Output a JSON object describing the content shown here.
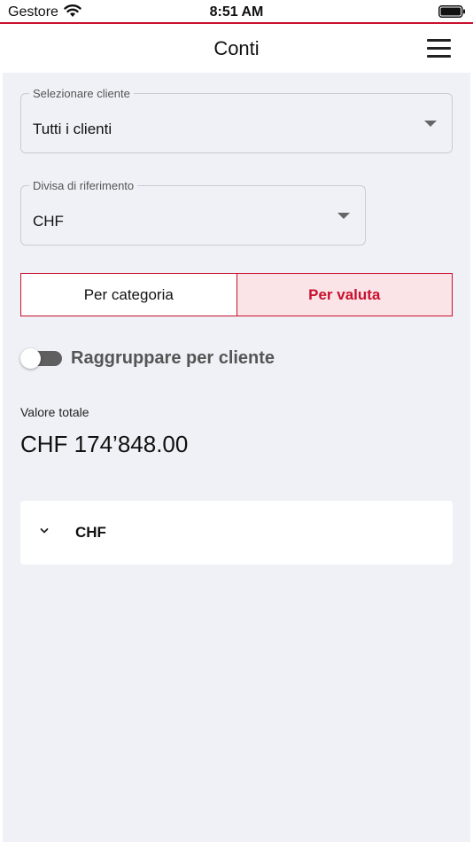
{
  "status_bar": {
    "carrier": "Gestore",
    "time": "8:51 AM",
    "icons": [
      "wifi-icon",
      "battery-icon"
    ]
  },
  "nav": {
    "title": "Conti",
    "menu_icon": "hamburger-menu-icon"
  },
  "filters": {
    "client": {
      "label": "Selezionare cliente",
      "value": "Tutti i clienti"
    },
    "currency": {
      "label": "Divisa di riferimento",
      "value": "CHF"
    }
  },
  "segmented": {
    "options": [
      "Per categoria",
      "Per valuta"
    ],
    "selected": "Per valuta"
  },
  "group_toggle": {
    "label": "Raggruppare per cliente",
    "on": false
  },
  "total": {
    "label": "Valore totale",
    "value": "CHF 174’848.00"
  },
  "groups": [
    {
      "label": "CHF",
      "expanded": false
    }
  ],
  "colors": {
    "accent": "#c8102e",
    "accent_light": "#fbe4e7",
    "background": "#eff1f6"
  }
}
